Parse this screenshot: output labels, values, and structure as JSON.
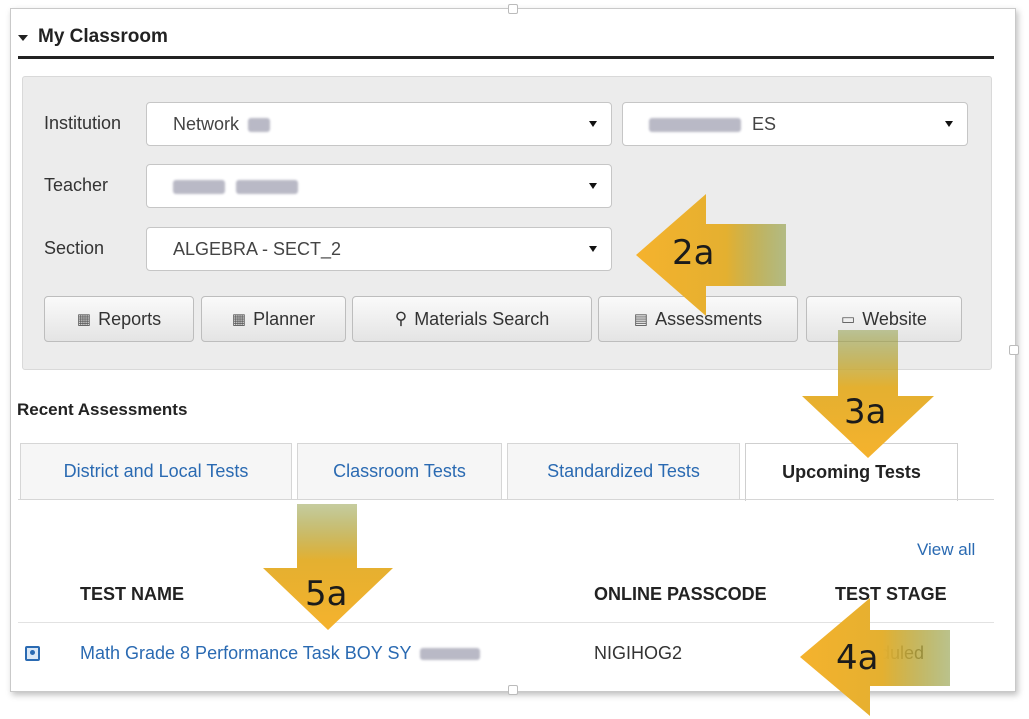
{
  "panel": {
    "title": "My Classroom"
  },
  "filters": {
    "institution_label": "Institution",
    "institution_value": "Network",
    "school_value": "ES",
    "teacher_label": "Teacher",
    "section_label": "Section",
    "section_value": "ALGEBRA - SECT_2"
  },
  "toolbar": {
    "buttons": [
      {
        "label": "Reports",
        "icon": "bar-chart-icon"
      },
      {
        "label": "Planner",
        "icon": "calendar-icon"
      },
      {
        "label": "Materials Search",
        "icon": "search-icon"
      },
      {
        "label": "Assessments",
        "icon": "assessment-icon"
      },
      {
        "label": "Website",
        "icon": "laptop-icon"
      }
    ]
  },
  "recent": {
    "heading": "Recent Assessments",
    "tabs": [
      {
        "label": "District and Local Tests",
        "active": false
      },
      {
        "label": "Classroom Tests",
        "active": false
      },
      {
        "label": "Standardized Tests",
        "active": false
      },
      {
        "label": "Upcoming Tests",
        "active": true
      }
    ],
    "view_all": "View all",
    "columns": [
      "TEST NAME",
      "ONLINE PASSCODE",
      "TEST STAGE"
    ],
    "rows": [
      {
        "test_name": "Math Grade 8 Performance Task BOY SY",
        "passcode": "NIGIHOG2",
        "stage": "duled"
      }
    ]
  },
  "callouts": [
    {
      "label": "2a"
    },
    {
      "label": "3a"
    },
    {
      "label": "4a"
    },
    {
      "label": "5a"
    }
  ],
  "colors": {
    "link": "#2a6ab2",
    "callout_arrow": "#f5b22d",
    "callout_tail": "#9aa040"
  }
}
